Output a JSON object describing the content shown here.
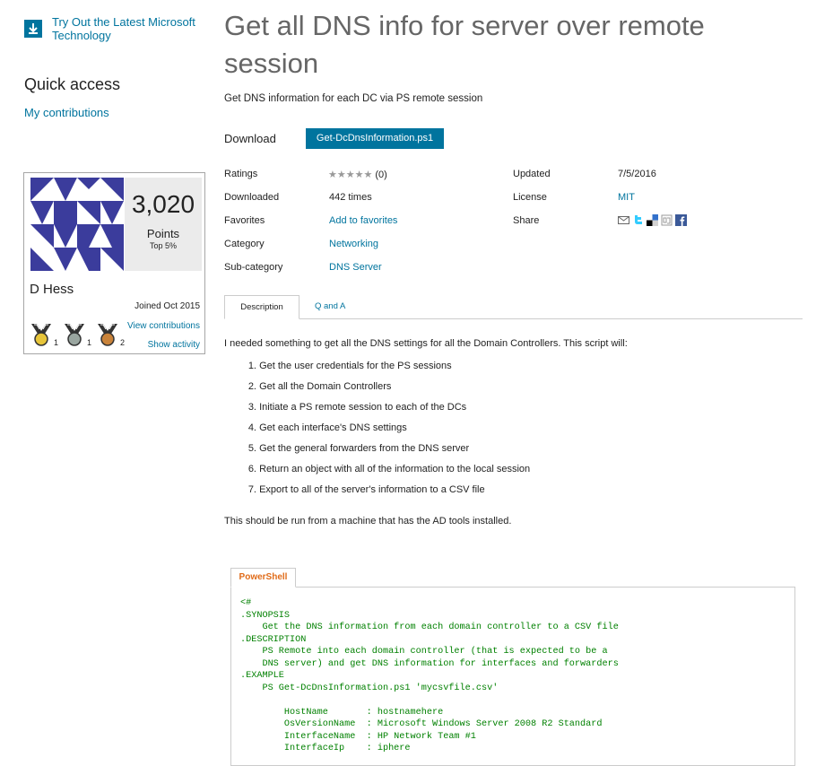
{
  "sidebar": {
    "try_link": "Try Out the Latest Microsoft Technology",
    "quick_access_title": "Quick access",
    "my_contributions": "My contributions"
  },
  "profile": {
    "points": "3,020",
    "points_label": "Points",
    "points_rank": "Top 5%",
    "name": "D Hess",
    "joined": "Joined Oct 2015",
    "medals": [
      {
        "color": "#e7c53a",
        "count": "1"
      },
      {
        "color": "#9aa6a0",
        "count": "1"
      },
      {
        "color": "#c9833a",
        "count": "2"
      }
    ],
    "view_contributions": "View contributions",
    "show_activity": "Show activity"
  },
  "page": {
    "title": "Get all DNS info for server over remote session",
    "subtitle": "Get DNS information for each DC via PS remote session",
    "download_label": "Download",
    "download_button": "Get-DcDnsInformation.ps1"
  },
  "meta": {
    "ratings_label": "Ratings",
    "ratings_stars": "★★★★★",
    "ratings_count": "(0)",
    "downloaded_label": "Downloaded",
    "downloaded_value": "442 times",
    "favorites_label": "Favorites",
    "favorites_value": "Add to favorites",
    "category_label": "Category",
    "category_value": "Networking",
    "subcategory_label": "Sub-category",
    "subcategory_value": "DNS Server",
    "updated_label": "Updated",
    "updated_value": "7/5/2016",
    "license_label": "License",
    "license_value": "MIT",
    "share_label": "Share"
  },
  "tabs": {
    "description": "Description",
    "qa": "Q and A"
  },
  "description": {
    "intro": "I needed something to get all the DNS settings for all the Domain Controllers.  This script will:",
    "steps": [
      {
        "num": "1.",
        "text": "Get the user credentials for the PS sessions"
      },
      {
        "num": "2.",
        "text": "Get all the Domain Controllers"
      },
      {
        "num": "3.",
        "text": "Initiate a PS remote session to each of the DCs"
      },
      {
        "num": "4.",
        "text": "Get each interface's DNS settings"
      },
      {
        "num": "5.",
        "text": "Get the general forwarders from the DNS server"
      },
      {
        "num": "6.",
        "text": "Return an object with all of the information to the local session"
      },
      {
        "num": "7.",
        "text": "Export to all of the server's information to a CSV file"
      }
    ],
    "outro": "This should be run from a machine that has the AD tools installed."
  },
  "code": {
    "tab_label": "PowerShell",
    "text": "<#\n.SYNOPSIS\n    Get the DNS information from each domain controller to a CSV file\n.DESCRIPTION\n    PS Remote into each domain controller (that is expected to be a\n    DNS server) and get DNS information for interfaces and forwarders\n.EXAMPLE\n    PS Get-DcDnsInformation.ps1 'mycsvfile.csv'\n\n        HostName       : hostnamehere\n        OsVersionName  : Microsoft Windows Server 2008 R2 Standard\n        InterfaceName  : HP Network Team #1\n        InterfaceIp    : iphere"
  },
  "colors": {
    "accent": "#00749e",
    "code_green": "#008000",
    "powershell_orange": "#e06c1a",
    "avatar_blue": "#3b3c9c"
  },
  "icons": [
    "download-icon",
    "star-icon",
    "email-icon",
    "twitter-icon",
    "delicious-icon",
    "digg-icon",
    "facebook-icon",
    "medal-icon"
  ]
}
